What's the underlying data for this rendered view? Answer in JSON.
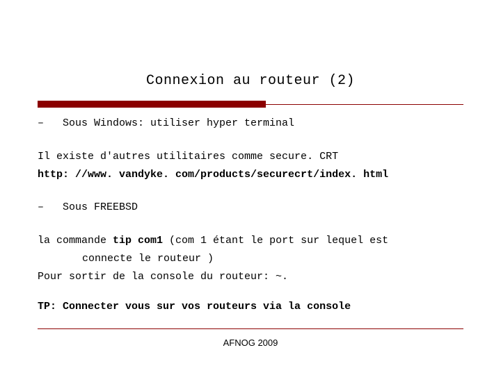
{
  "title": "Connexion au routeur (2)",
  "bullets": {
    "b1_dash": "–",
    "b1_text": "Sous Windows: utiliser hyper terminal",
    "b2_dash": "–",
    "b2_text": "Sous FREEBSD"
  },
  "p1_line1": "Il existe d'autres utilitaires comme secure. CRT",
  "p1_line2_bold": "http: //www. vandyke. com/products/securecrt/index. html",
  "p2_a": "la commande ",
  "p2_b_bold": "tip com1 ",
  "p2_c": " (com 1 étant le port sur lequel est",
  "p2_cont": "connecte le routeur )",
  "p2_line2": "Pour sortir de la console du routeur:   ~.",
  "tp_bold": "TP: Connecter vous sur vos routeurs via la console",
  "footer": "AFNOG 2009"
}
